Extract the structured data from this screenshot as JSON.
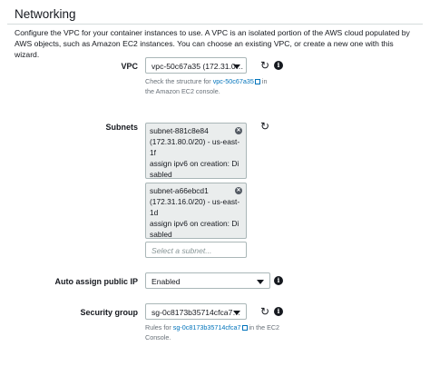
{
  "section": {
    "title": "Networking",
    "description": "Configure the VPC for your container instances to use. A VPC is an isolated portion of the AWS cloud populated by AWS objects, such as Amazon EC2 instances. You can choose an existing VPC, or create a new one with this wizard."
  },
  "vpc": {
    "label": "VPC",
    "value": "vpc-50c67a35 (172.31.0…",
    "help_prefix": "Check the structure for ",
    "help_link": "vpc-50c67a35",
    "help_suffix": " in the Amazon EC2 console."
  },
  "subnets": {
    "label": "Subnets",
    "selected": [
      {
        "lines": [
          "subnet-881c8e84",
          "(172.31.80.0/20) - us-east-",
          "1f",
          "assign ipv6 on creation: Di",
          "sabled"
        ]
      },
      {
        "lines": [
          "subnet-a66ebcd1",
          "(172.31.16.0/20) - us-east-",
          "1d",
          "assign ipv6 on creation: Di",
          "sabled"
        ]
      }
    ],
    "placeholder": "Select a subnet..."
  },
  "auto_assign_ip": {
    "label": "Auto assign public IP",
    "value": "Enabled"
  },
  "security_group": {
    "label": "Security group",
    "value": "sg-0c8173b35714cfca7…",
    "help_prefix": "Rules for ",
    "help_link": "sg-0c8173b35714cfca7",
    "help_suffix": " in the EC2 Console."
  },
  "icons": {
    "refresh": "refresh-icon",
    "info": "info-icon",
    "remove": "close-icon",
    "external": "external-link-icon"
  },
  "colors": {
    "link": "#0073bb",
    "token_bg": "#eaeded"
  }
}
